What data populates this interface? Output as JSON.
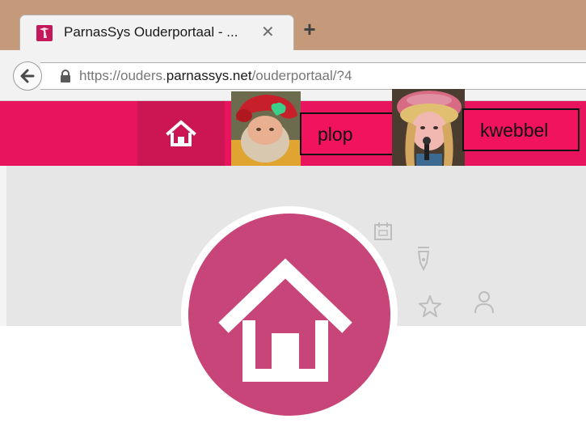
{
  "browser": {
    "tab": {
      "title": "ParnasSys Ouderportaal - ...",
      "close_glyph": "✕",
      "favicon": "parnassys-favicon"
    },
    "new_tab_glyph": "+",
    "url": {
      "prefix": "https://ouders.",
      "domain": "parnassys.net",
      "suffix": "/ouderportaal/?4"
    },
    "icons": [
      "back-arrow-icon",
      "lock-icon"
    ]
  },
  "app": {
    "nav": {
      "home_icon": "home-icon"
    },
    "children": [
      {
        "name": "plop",
        "avatar": "avatar-photo"
      },
      {
        "name": "kwebbel",
        "avatar": "avatar-photo"
      }
    ],
    "side_icons": [
      "calendar-icon",
      "pen-icon",
      "star-icon",
      "person-icon"
    ]
  },
  "colors": {
    "tabstrip": "#c49a7a",
    "appbar": "#e8155e",
    "home_tab_active": "#cb1653",
    "label_bg": "#f2135e",
    "home_circle": "#c74578",
    "content_bg": "#e6e6e6"
  }
}
